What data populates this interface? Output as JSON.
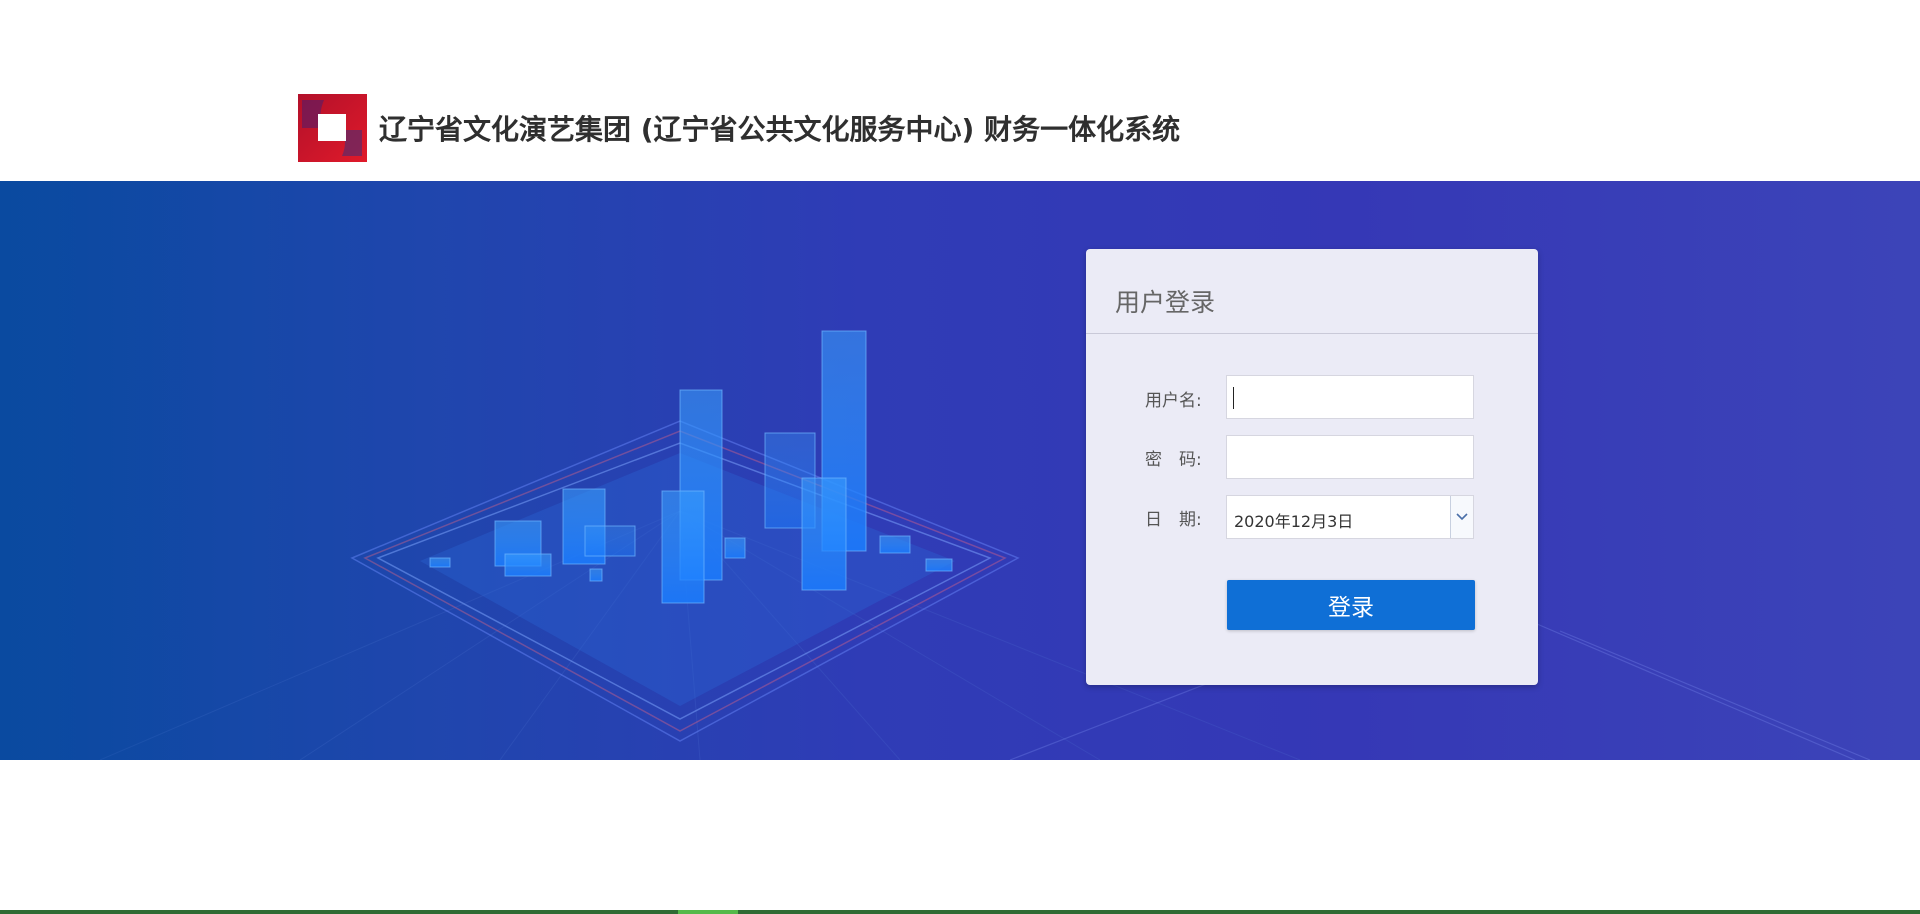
{
  "header": {
    "title": "辽宁省文化演艺集团 (辽宁省公共文化服务中心) 财务一体化系统",
    "logo_icon": "red-square-logo-icon"
  },
  "login": {
    "title": "用户登录",
    "username_label": "用户名:",
    "username_value": "",
    "password_label": "密　码:",
    "password_value": "",
    "date_label": "日　期:",
    "date_value": "2020年12月3日",
    "submit_label": "登录"
  },
  "colors": {
    "banner_start": "#0a4aa0",
    "banner_end": "#3c44b8",
    "card_bg": "#ebebf6",
    "button": "#0f6fd6",
    "logo_red": "#d4102a"
  }
}
